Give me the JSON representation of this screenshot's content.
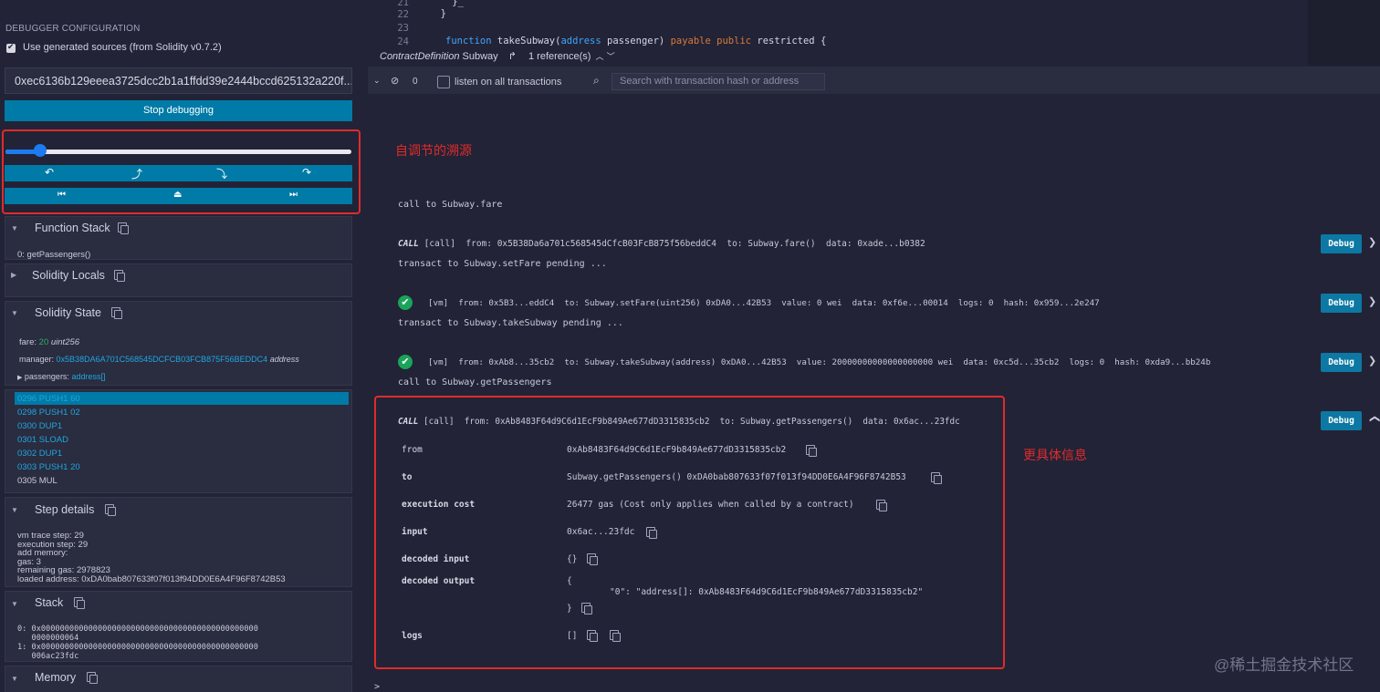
{
  "left": {
    "header": "DEBUGGER CONFIGURATION",
    "use_generated_label": "Use generated sources (from Solidity v0.7.2)",
    "tx_hash": "0xec6136b129eeea3725dcc2b1a1ffdd39e2444bccd625132a220f...",
    "stop_label": "Stop debugging",
    "slider_value": 0.1,
    "nav_icons": [
      "step-back-icon",
      "step-out-icon",
      "step-into-icon",
      "step-over-icon"
    ],
    "jump_icons": [
      "jump-prev-breakpoint-icon",
      "jump-out-icon",
      "jump-next-breakpoint-icon"
    ],
    "nav_glyphs": [
      "↶",
      "⤴",
      "⤵",
      "↷"
    ],
    "jump_glyphs": [
      "⏮",
      "⏏",
      "⏭"
    ],
    "function_stack": {
      "title": "Function Stack",
      "items": [
        "0: getPassengers()"
      ]
    },
    "solidity_locals": {
      "title": "Solidity Locals"
    },
    "solidity_state": {
      "title": "Solidity State",
      "fare_key": "fare:",
      "fare_value": "20",
      "fare_type": "uint256",
      "manager_key": "manager:",
      "manager_value": "0x5B38DA6A701C568545DCFCB03FCB875F56BEDDC4",
      "manager_type": "address",
      "passengers_key": "passengers:",
      "passengers_value": "address[]"
    },
    "opcodes": [
      "0296 PUSH1 60",
      "0298 PUSH1 02",
      "0300 DUP1",
      "0301 SLOAD",
      "0302 DUP1",
      "0303 PUSH1 20",
      "0305 MUL"
    ],
    "step_details": {
      "title": "Step details",
      "lines": [
        "vm trace step: 29",
        "execution step: 29",
        "add memory:",
        "gas: 3",
        "remaining gas: 2978823",
        "loaded address: 0xDA0bab807633f07f013f94DD0E6A4F96F8742B53"
      ]
    },
    "stack": {
      "title": "Stack",
      "lines": [
        "0: 0x0000000000000000000000000000000000000000000000",
        "   0000000064",
        "1: 0x0000000000000000000000000000000000000000000000",
        "   006ac23fdc"
      ]
    },
    "memory": {
      "title": "Memory"
    }
  },
  "editor": {
    "lines": [
      {
        "n": "21",
        "code": "    }_"
      },
      {
        "n": "22",
        "code": "  }"
      },
      {
        "n": "23",
        "code": ""
      },
      {
        "n": "24",
        "code_parts": [
          "function",
          " takeSubway(",
          "address",
          " passenger) ",
          "payable",
          " ",
          "public",
          " restricted {"
        ]
      }
    ],
    "contract_def": "ContractDefinition",
    "contract_name": "Subway",
    "references": "1 reference(s)"
  },
  "terminal": {
    "count": "0",
    "listen_label": "listen on all transactions",
    "search_placeholder": "Search with transaction hash or address",
    "lines": [
      {
        "kind": "plain",
        "text": "call to Subway.fare"
      },
      {
        "kind": "tx",
        "tag": "CALL",
        "body": "[call]  from: 0x5B38Da6a701c568545dCfcB03FcB875f56beddC4  to: Subway.fare()  data: 0xade...b0382"
      },
      {
        "kind": "plain",
        "text": "transact to Subway.setFare pending ..."
      },
      {
        "kind": "tx",
        "tag": "✔",
        "body": "[vm]  from: 0x5B3...eddC4  to: Subway.setFare(uint256) 0xDA0...42B53  value: 0 wei  data: 0xf6e...00014  logs: 0  hash: 0x959...2e247"
      },
      {
        "kind": "plain",
        "text": "transact to Subway.takeSubway pending ..."
      },
      {
        "kind": "tx",
        "tag": "✔",
        "body": "[vm]  from: 0xAb8...35cb2  to: Subway.takeSubway(address) 0xDA0...42B53  value: 20000000000000000000 wei  data: 0xc5d...35cb2  logs: 0  hash: 0xda9...bb24b"
      },
      {
        "kind": "plain",
        "text": "call to Subway.getPassengers"
      },
      {
        "kind": "tx",
        "tag": "CALL",
        "body": "[call]  from: 0xAb8483F64d9C6d1EcF9b849Ae677dD3315835cb2  to: Subway.getPassengers()  data: 0x6ac...23fdc"
      }
    ],
    "debug_label": "Debug",
    "details": [
      {
        "k": "from",
        "v": "0xAb8483F64d9C6d1EcF9b849Ae677dD3315835cb2"
      },
      {
        "k": "to",
        "v": "Subway.getPassengers() 0xDA0bab807633f07f013f94DD0E6A4F96F8742B53"
      },
      {
        "k": "execution cost",
        "v": "26477 gas (Cost only applies when called by a contract)"
      },
      {
        "k": "input",
        "v": "0x6ac...23fdc"
      },
      {
        "k": "decoded input",
        "v": "{}"
      },
      {
        "k": "decoded output",
        "v": "{"
      },
      {
        "k": "",
        "v": "\"0\": \"address[]: 0xAb8483F64d9C6d1EcF9b849Ae677dD3315835cb2\""
      },
      {
        "k": "",
        "v": "}"
      },
      {
        "k": "logs",
        "v": "[]"
      }
    ],
    "prompt": ">"
  },
  "annotations": {
    "slider_note": "自调节的溯源",
    "detail_note": "更具体信息",
    "color": "#e02b2b"
  },
  "watermark": "@稀土掘金技术社区"
}
